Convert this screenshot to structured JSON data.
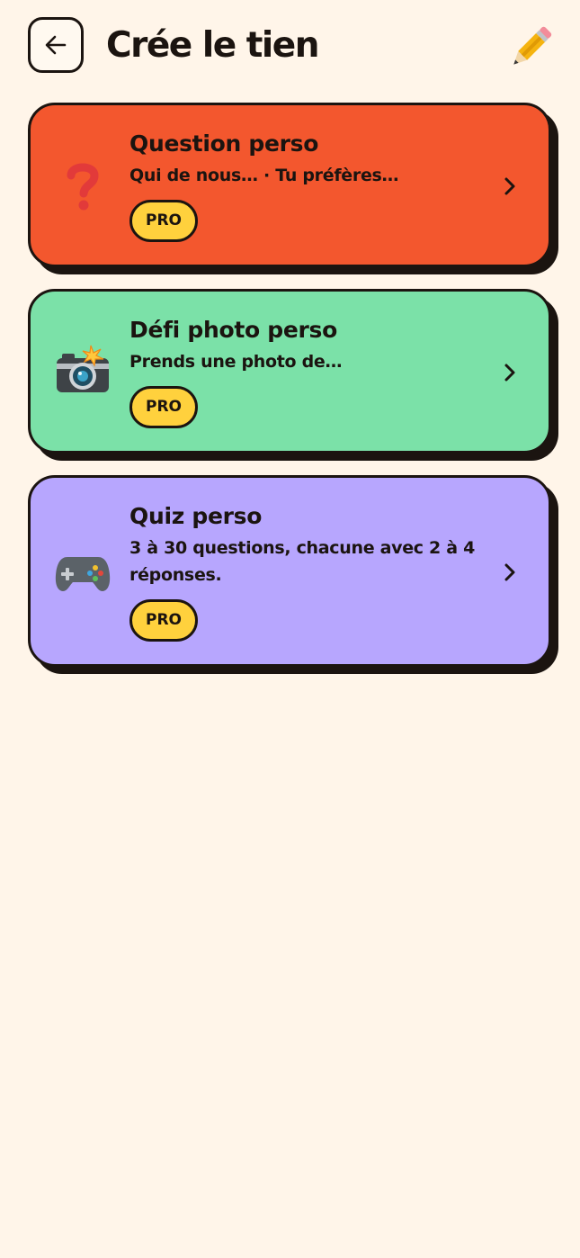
{
  "header": {
    "title": "Crée le tien",
    "back_icon": "arrow-left-icon",
    "decor_icon": "pencil-icon"
  },
  "cards": [
    {
      "title": "Question perso",
      "subtitle": "Qui de nous… · Tu préfères…",
      "badge": "PRO",
      "icon": "question-mark-icon",
      "color": "#F3572E"
    },
    {
      "title": "Défi photo perso",
      "subtitle": "Prends une photo de…",
      "badge": "PRO",
      "icon": "camera-flash-icon",
      "color": "#7BE1A8"
    },
    {
      "title": "Quiz perso",
      "subtitle": "3 à 30 questions, chacune avec 2 à 4 réponses.",
      "badge": "PRO",
      "icon": "game-controller-icon",
      "color": "#B7A6FE"
    }
  ],
  "colors": {
    "background": "#FFF5E9",
    "ink": "#1B1410",
    "pro_badge": "#FFD13D"
  }
}
